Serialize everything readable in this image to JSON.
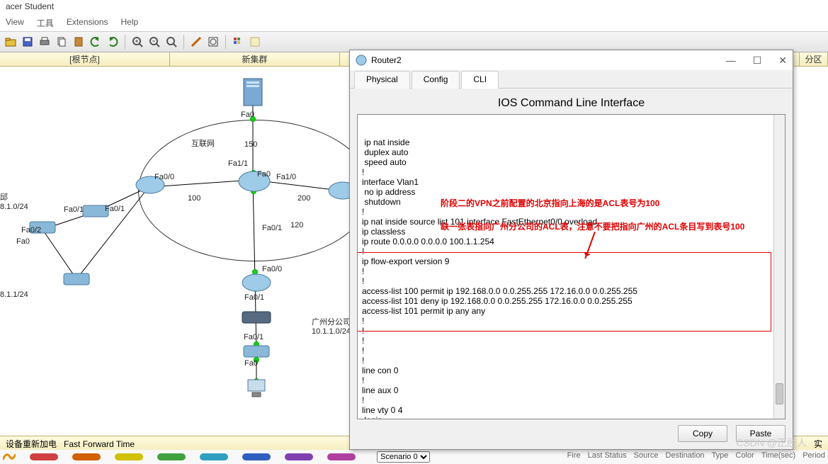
{
  "app": {
    "title": "acer Student"
  },
  "menu": {
    "view": "View",
    "tools": "工具",
    "extensions": "Extensions",
    "help": "Help"
  },
  "tabs": {
    "root": "[根节点]",
    "cluster": "新集群",
    "zone": "分区"
  },
  "status": {
    "left": "设备重新加电",
    "fft": "Fast Forward Time",
    "realtime": "实"
  },
  "scenario": {
    "label": "Scenario 0"
  },
  "cols": {
    "fire": "Fire",
    "last": "Last Status",
    "src": "Source",
    "dst": "Destination",
    "type": "Type",
    "color": "Color",
    "time": "Time(sec)",
    "period": "Period"
  },
  "labels": {
    "internet": "互联网",
    "w150": "150",
    "w100": "100",
    "w200": "200",
    "w120": "120",
    "fa0": "Fa0",
    "fa01": "Fa0/1",
    "fa02": "Fa0/2",
    "fa00": "Fa0/0",
    "fa10": "Fa1/0",
    "fa11": "Fa1/1",
    "fa0_a": "Fa0",
    "net1": "邱\n8.1.0/24",
    "net2": "8.1.1/24",
    "gz": "广州分公司\n10.1.1.0/24"
  },
  "dialog": {
    "title": "Router2",
    "tabs": {
      "physical": "Physical",
      "config": "Config",
      "cli": "CLI"
    },
    "cli_title": "IOS Command Line Interface",
    "cli_lines": [
      " ip nat inside",
      " duplex auto",
      " speed auto",
      "!",
      "interface Vlan1",
      " no ip address",
      " shutdown",
      "!",
      "ip nat inside source list 101 interface FastEthernet0/0 overload",
      "ip classless",
      "ip route 0.0.0.0 0.0.0.0 100.1.1.254",
      "!",
      "ip flow-export version 9",
      "!",
      "!",
      "access-list 100 permit ip 192.168.0.0 0.0.255.255 172.16.0.0 0.0.255.255",
      "access-list 101 deny ip 192.168.0.0 0.0.255.255 172.16.0.0 0.0.255.255",
      "access-list 101 permit ip any any",
      "!",
      "!",
      "!",
      "!",
      "!",
      "line con 0",
      "!",
      "line aux 0",
      "!",
      "line vty 0 4",
      " login",
      "!"
    ],
    "copy": "Copy",
    "paste": "Paste"
  },
  "annotations": {
    "a1": "阶段二的VPN之前配置的北京指向上海的是ACL表号为100",
    "a2": "缺一张表指向广州分公司的ACL表，注意不要把指向广州的ACL条目写到表号100"
  },
  "watermark": "CSDN @正经人"
}
